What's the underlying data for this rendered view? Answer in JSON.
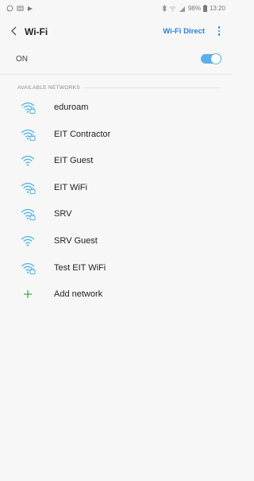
{
  "status_bar": {
    "left_icons": [
      "whatsapp-icon",
      "message-icon",
      "play-store-icon"
    ],
    "right_icons": [
      "bluetooth-icon",
      "wifi-icon",
      "signal-icon"
    ],
    "battery": "98%",
    "time": "13:20"
  },
  "header": {
    "title": "Wi-Fi",
    "wifi_direct_label": "Wi-Fi Direct"
  },
  "wifi_toggle": {
    "label": "ON",
    "state": "on"
  },
  "section_title": "AVAILABLE NETWORKS",
  "networks": [
    {
      "name": "eduroam",
      "secured": true
    },
    {
      "name": "EIT Contractor",
      "secured": true
    },
    {
      "name": "EIT Guest",
      "secured": false
    },
    {
      "name": "EIT WiFi",
      "secured": true
    },
    {
      "name": "SRV",
      "secured": true
    },
    {
      "name": "SRV Guest",
      "secured": false
    },
    {
      "name": "Test EIT WiFi",
      "secured": true
    }
  ],
  "add_network_label": "Add network",
  "colors": {
    "accent": "#2b7fd6",
    "wifi_icon": "#4fb3e8",
    "toggle": "#5bb0ea",
    "background": "#f7f7f7"
  }
}
